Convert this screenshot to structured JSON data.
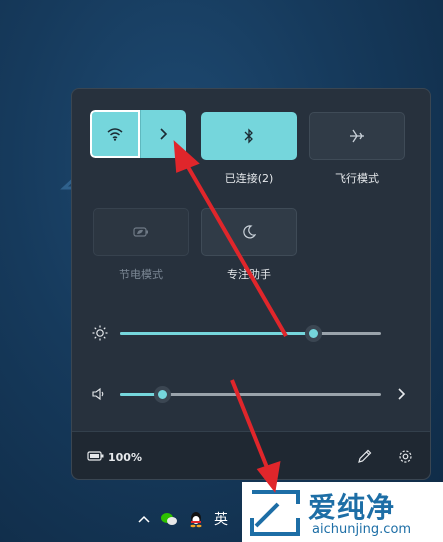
{
  "quick_settings": {
    "tiles": [
      {
        "id": "wifi",
        "label": "",
        "state": "on",
        "icon": "wifi-icon"
      },
      {
        "id": "bluetooth",
        "label": "已连接(2)",
        "state": "on",
        "icon": "bluetooth-icon"
      },
      {
        "id": "airplane",
        "label": "飞行模式",
        "state": "off",
        "icon": "airplane-icon"
      },
      {
        "id": "battery_saver",
        "label": "节电模式",
        "state": "disabled",
        "icon": "leaf-icon"
      },
      {
        "id": "focus_assist",
        "label": "专注助手",
        "state": "off",
        "icon": "moon-icon"
      }
    ],
    "brightness_level": 0.74,
    "volume_level": 0.16,
    "battery_text": "100%"
  },
  "taskbar": {
    "language": "英"
  },
  "watermark": {
    "brand_cn": "爱纯净",
    "brand_url": "aichunjing.com"
  },
  "colors": {
    "accent": "#75d6dc",
    "panel": "#27313d",
    "annotation_arrow": "#e0262b"
  }
}
